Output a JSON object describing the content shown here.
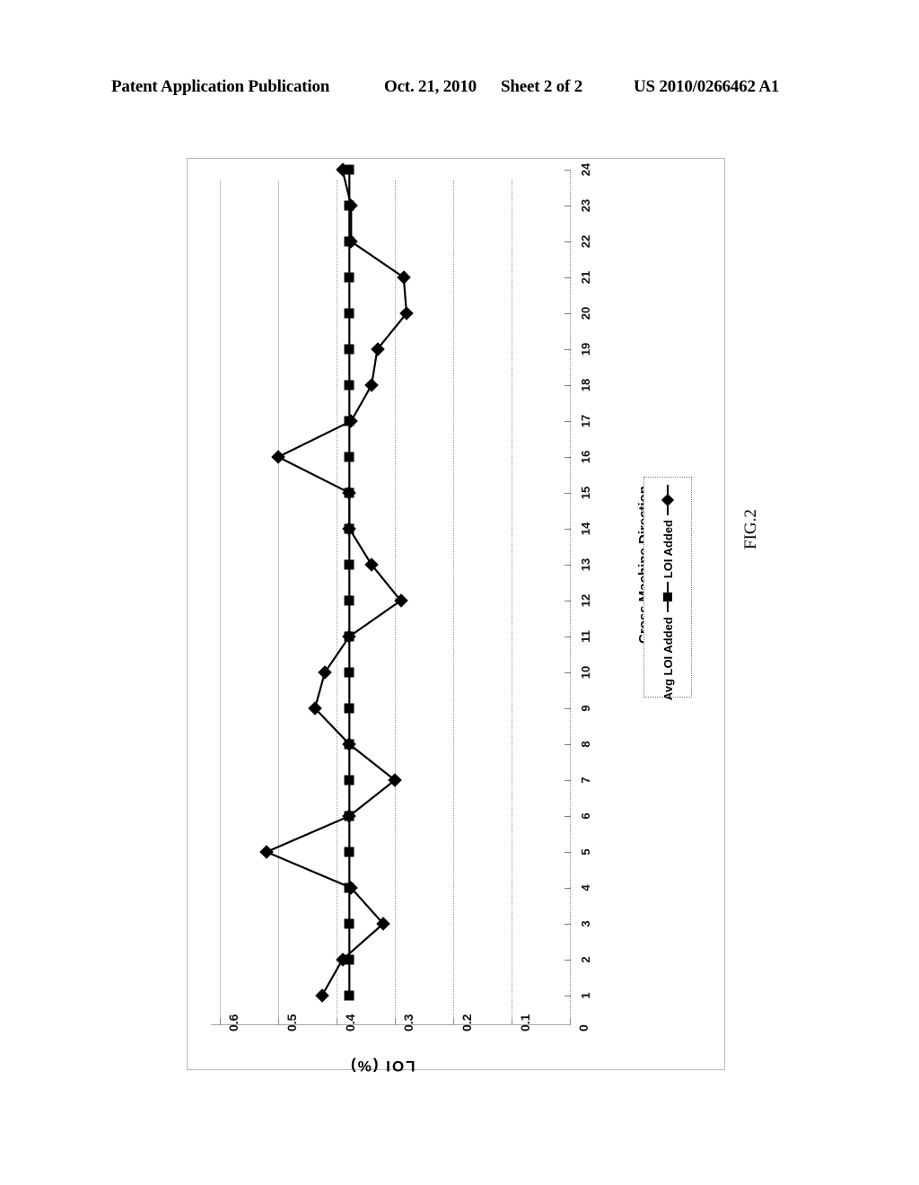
{
  "header": {
    "publication": "Patent Application Publication",
    "date": "Oct. 21, 2010",
    "sheet": "Sheet 2 of 2",
    "number": "US 2010/0266462 A1"
  },
  "figure": {
    "caption": "FIG.2"
  },
  "legend": {
    "position": "right-middle",
    "entries": [
      {
        "label": "LOI Added",
        "marker": "diamond"
      },
      {
        "label": "Avg LOI Added",
        "marker": "square"
      }
    ]
  },
  "chart_data": {
    "type": "line",
    "title": "",
    "orientation": "rotated-90",
    "xlabel": "Cross Machine Direction",
    "ylabel": "LOI (%)",
    "categories": [
      1,
      2,
      3,
      4,
      5,
      6,
      7,
      8,
      9,
      10,
      11,
      12,
      13,
      14,
      15,
      16,
      17,
      18,
      19,
      20,
      21,
      22,
      23,
      24
    ],
    "category_tick_labels": [
      "1",
      "2",
      "3",
      "4",
      "5",
      "6",
      "7",
      "8",
      "9",
      "10",
      "11",
      "12",
      "13",
      "14",
      "15",
      "16",
      "17",
      "18",
      "19",
      "20",
      "21",
      "22",
      "23",
      "24"
    ],
    "ylim": [
      0,
      0.6
    ],
    "ytick_labels": [
      "0.6",
      "0.5",
      "0.4",
      "0.3",
      "0.2",
      "0.1",
      "0"
    ],
    "yticks": [
      0.6,
      0.5,
      0.4,
      0.3,
      0.2,
      0.1,
      0
    ],
    "grid": true,
    "series": [
      {
        "name": "LOI Added",
        "marker": "diamond",
        "values": [
          0.425,
          0.39,
          0.32,
          0.375,
          0.52,
          0.378,
          0.3,
          0.378,
          0.437,
          0.42,
          0.378,
          0.29,
          0.34,
          0.378,
          0.378,
          0.5,
          0.375,
          0.34,
          0.33,
          0.28,
          0.285,
          0.375,
          0.375,
          0.39
        ]
      },
      {
        "name": "Avg LOI Added",
        "marker": "square",
        "values": [
          0.378,
          0.378,
          0.378,
          0.378,
          0.378,
          0.378,
          0.378,
          0.378,
          0.378,
          0.378,
          0.378,
          0.378,
          0.378,
          0.378,
          0.378,
          0.378,
          0.378,
          0.378,
          0.378,
          0.378,
          0.378,
          0.378,
          0.378,
          0.378
        ]
      }
    ]
  }
}
